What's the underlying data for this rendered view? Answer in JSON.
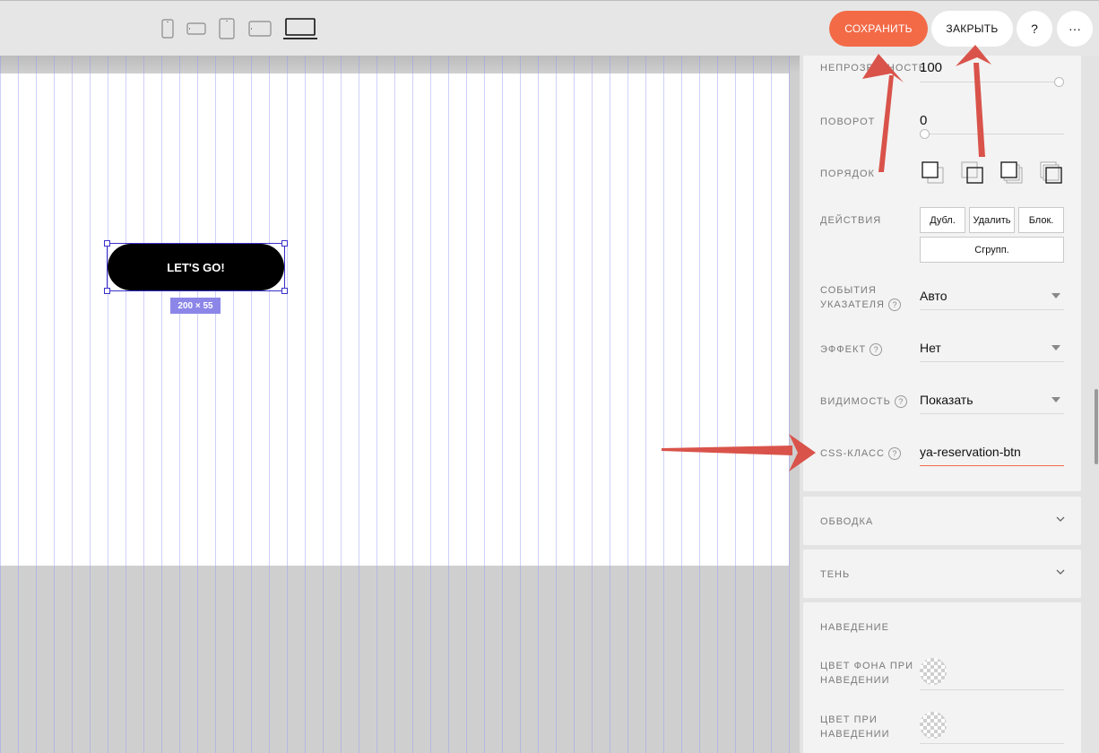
{
  "toolbar": {
    "devices": [
      "phone-portrait-icon",
      "phone-landscape-icon",
      "tablet-portrait-icon",
      "tablet-landscape-icon",
      "laptop-icon"
    ],
    "save_label": "СОХРАНИТЬ",
    "close_label": "ЗАКРЫТЬ",
    "help_label": "?",
    "more_label": "···"
  },
  "canvas": {
    "button_text": "LET'S GO!",
    "size_label": "200 × 55"
  },
  "panel": {
    "opacity": {
      "label": "НЕПРОЗРАЧНОСТЬ",
      "value": "100",
      "level": 1.0
    },
    "rotation": {
      "label": "ПОВОРОТ",
      "value": "0",
      "level": 0.0
    },
    "order": {
      "label": "ПОРЯДОК"
    },
    "actions": {
      "label": "ДЕЙСТВИЯ",
      "duplicate": "Дубл.",
      "delete": "Удалить",
      "lock": "Блок.",
      "group": "Сгрупп."
    },
    "pointer_events": {
      "label_line1": "СОБЫТИЯ",
      "label_line2": "УКАЗАТЕЛЯ",
      "value": "Авто"
    },
    "effect": {
      "label": "ЭФФЕКТ",
      "value": "Нет"
    },
    "visibility": {
      "label": "ВИДИМОСТЬ",
      "value": "Показать"
    },
    "css_class": {
      "label": "CSS-КЛАСС",
      "value": "ya-reservation-btn"
    },
    "help_glyph": "?",
    "border": {
      "label": "ОБВОДКА"
    },
    "shadow": {
      "label": "ТЕНЬ"
    },
    "hover": {
      "label": "НАВЕДЕНИЕ",
      "bg_color_line1": "ЦВЕТ ФОНА ПРИ",
      "bg_color_line2": "НАВЕДЕНИИ",
      "color_line1": "ЦВЕТ ПРИ",
      "color_line2": "НАВЕДЕНИИ"
    }
  },
  "colors": {
    "accent": "#f36a47",
    "arrow": "#d9534a",
    "selection": "#3a30c8",
    "size_tag": "#8c86e8"
  }
}
